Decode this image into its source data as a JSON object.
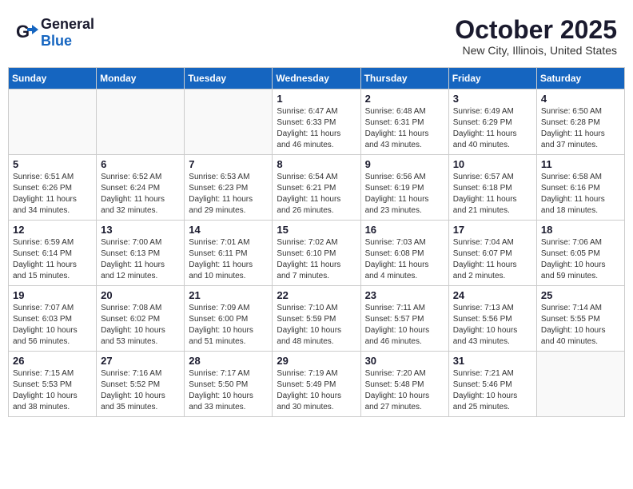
{
  "header": {
    "logo_general": "General",
    "logo_blue": "Blue",
    "month_title": "October 2025",
    "location": "New City, Illinois, United States"
  },
  "weekdays": [
    "Sunday",
    "Monday",
    "Tuesday",
    "Wednesday",
    "Thursday",
    "Friday",
    "Saturday"
  ],
  "weeks": [
    [
      {
        "day": "",
        "info": ""
      },
      {
        "day": "",
        "info": ""
      },
      {
        "day": "",
        "info": ""
      },
      {
        "day": "1",
        "info": "Sunrise: 6:47 AM\nSunset: 6:33 PM\nDaylight: 11 hours\nand 46 minutes."
      },
      {
        "day": "2",
        "info": "Sunrise: 6:48 AM\nSunset: 6:31 PM\nDaylight: 11 hours\nand 43 minutes."
      },
      {
        "day": "3",
        "info": "Sunrise: 6:49 AM\nSunset: 6:29 PM\nDaylight: 11 hours\nand 40 minutes."
      },
      {
        "day": "4",
        "info": "Sunrise: 6:50 AM\nSunset: 6:28 PM\nDaylight: 11 hours\nand 37 minutes."
      }
    ],
    [
      {
        "day": "5",
        "info": "Sunrise: 6:51 AM\nSunset: 6:26 PM\nDaylight: 11 hours\nand 34 minutes."
      },
      {
        "day": "6",
        "info": "Sunrise: 6:52 AM\nSunset: 6:24 PM\nDaylight: 11 hours\nand 32 minutes."
      },
      {
        "day": "7",
        "info": "Sunrise: 6:53 AM\nSunset: 6:23 PM\nDaylight: 11 hours\nand 29 minutes."
      },
      {
        "day": "8",
        "info": "Sunrise: 6:54 AM\nSunset: 6:21 PM\nDaylight: 11 hours\nand 26 minutes."
      },
      {
        "day": "9",
        "info": "Sunrise: 6:56 AM\nSunset: 6:19 PM\nDaylight: 11 hours\nand 23 minutes."
      },
      {
        "day": "10",
        "info": "Sunrise: 6:57 AM\nSunset: 6:18 PM\nDaylight: 11 hours\nand 21 minutes."
      },
      {
        "day": "11",
        "info": "Sunrise: 6:58 AM\nSunset: 6:16 PM\nDaylight: 11 hours\nand 18 minutes."
      }
    ],
    [
      {
        "day": "12",
        "info": "Sunrise: 6:59 AM\nSunset: 6:14 PM\nDaylight: 11 hours\nand 15 minutes."
      },
      {
        "day": "13",
        "info": "Sunrise: 7:00 AM\nSunset: 6:13 PM\nDaylight: 11 hours\nand 12 minutes."
      },
      {
        "day": "14",
        "info": "Sunrise: 7:01 AM\nSunset: 6:11 PM\nDaylight: 11 hours\nand 10 minutes."
      },
      {
        "day": "15",
        "info": "Sunrise: 7:02 AM\nSunset: 6:10 PM\nDaylight: 11 hours\nand 7 minutes."
      },
      {
        "day": "16",
        "info": "Sunrise: 7:03 AM\nSunset: 6:08 PM\nDaylight: 11 hours\nand 4 minutes."
      },
      {
        "day": "17",
        "info": "Sunrise: 7:04 AM\nSunset: 6:07 PM\nDaylight: 11 hours\nand 2 minutes."
      },
      {
        "day": "18",
        "info": "Sunrise: 7:06 AM\nSunset: 6:05 PM\nDaylight: 10 hours\nand 59 minutes."
      }
    ],
    [
      {
        "day": "19",
        "info": "Sunrise: 7:07 AM\nSunset: 6:03 PM\nDaylight: 10 hours\nand 56 minutes."
      },
      {
        "day": "20",
        "info": "Sunrise: 7:08 AM\nSunset: 6:02 PM\nDaylight: 10 hours\nand 53 minutes."
      },
      {
        "day": "21",
        "info": "Sunrise: 7:09 AM\nSunset: 6:00 PM\nDaylight: 10 hours\nand 51 minutes."
      },
      {
        "day": "22",
        "info": "Sunrise: 7:10 AM\nSunset: 5:59 PM\nDaylight: 10 hours\nand 48 minutes."
      },
      {
        "day": "23",
        "info": "Sunrise: 7:11 AM\nSunset: 5:57 PM\nDaylight: 10 hours\nand 46 minutes."
      },
      {
        "day": "24",
        "info": "Sunrise: 7:13 AM\nSunset: 5:56 PM\nDaylight: 10 hours\nand 43 minutes."
      },
      {
        "day": "25",
        "info": "Sunrise: 7:14 AM\nSunset: 5:55 PM\nDaylight: 10 hours\nand 40 minutes."
      }
    ],
    [
      {
        "day": "26",
        "info": "Sunrise: 7:15 AM\nSunset: 5:53 PM\nDaylight: 10 hours\nand 38 minutes."
      },
      {
        "day": "27",
        "info": "Sunrise: 7:16 AM\nSunset: 5:52 PM\nDaylight: 10 hours\nand 35 minutes."
      },
      {
        "day": "28",
        "info": "Sunrise: 7:17 AM\nSunset: 5:50 PM\nDaylight: 10 hours\nand 33 minutes."
      },
      {
        "day": "29",
        "info": "Sunrise: 7:19 AM\nSunset: 5:49 PM\nDaylight: 10 hours\nand 30 minutes."
      },
      {
        "day": "30",
        "info": "Sunrise: 7:20 AM\nSunset: 5:48 PM\nDaylight: 10 hours\nand 27 minutes."
      },
      {
        "day": "31",
        "info": "Sunrise: 7:21 AM\nSunset: 5:46 PM\nDaylight: 10 hours\nand 25 minutes."
      },
      {
        "day": "",
        "info": ""
      }
    ]
  ]
}
